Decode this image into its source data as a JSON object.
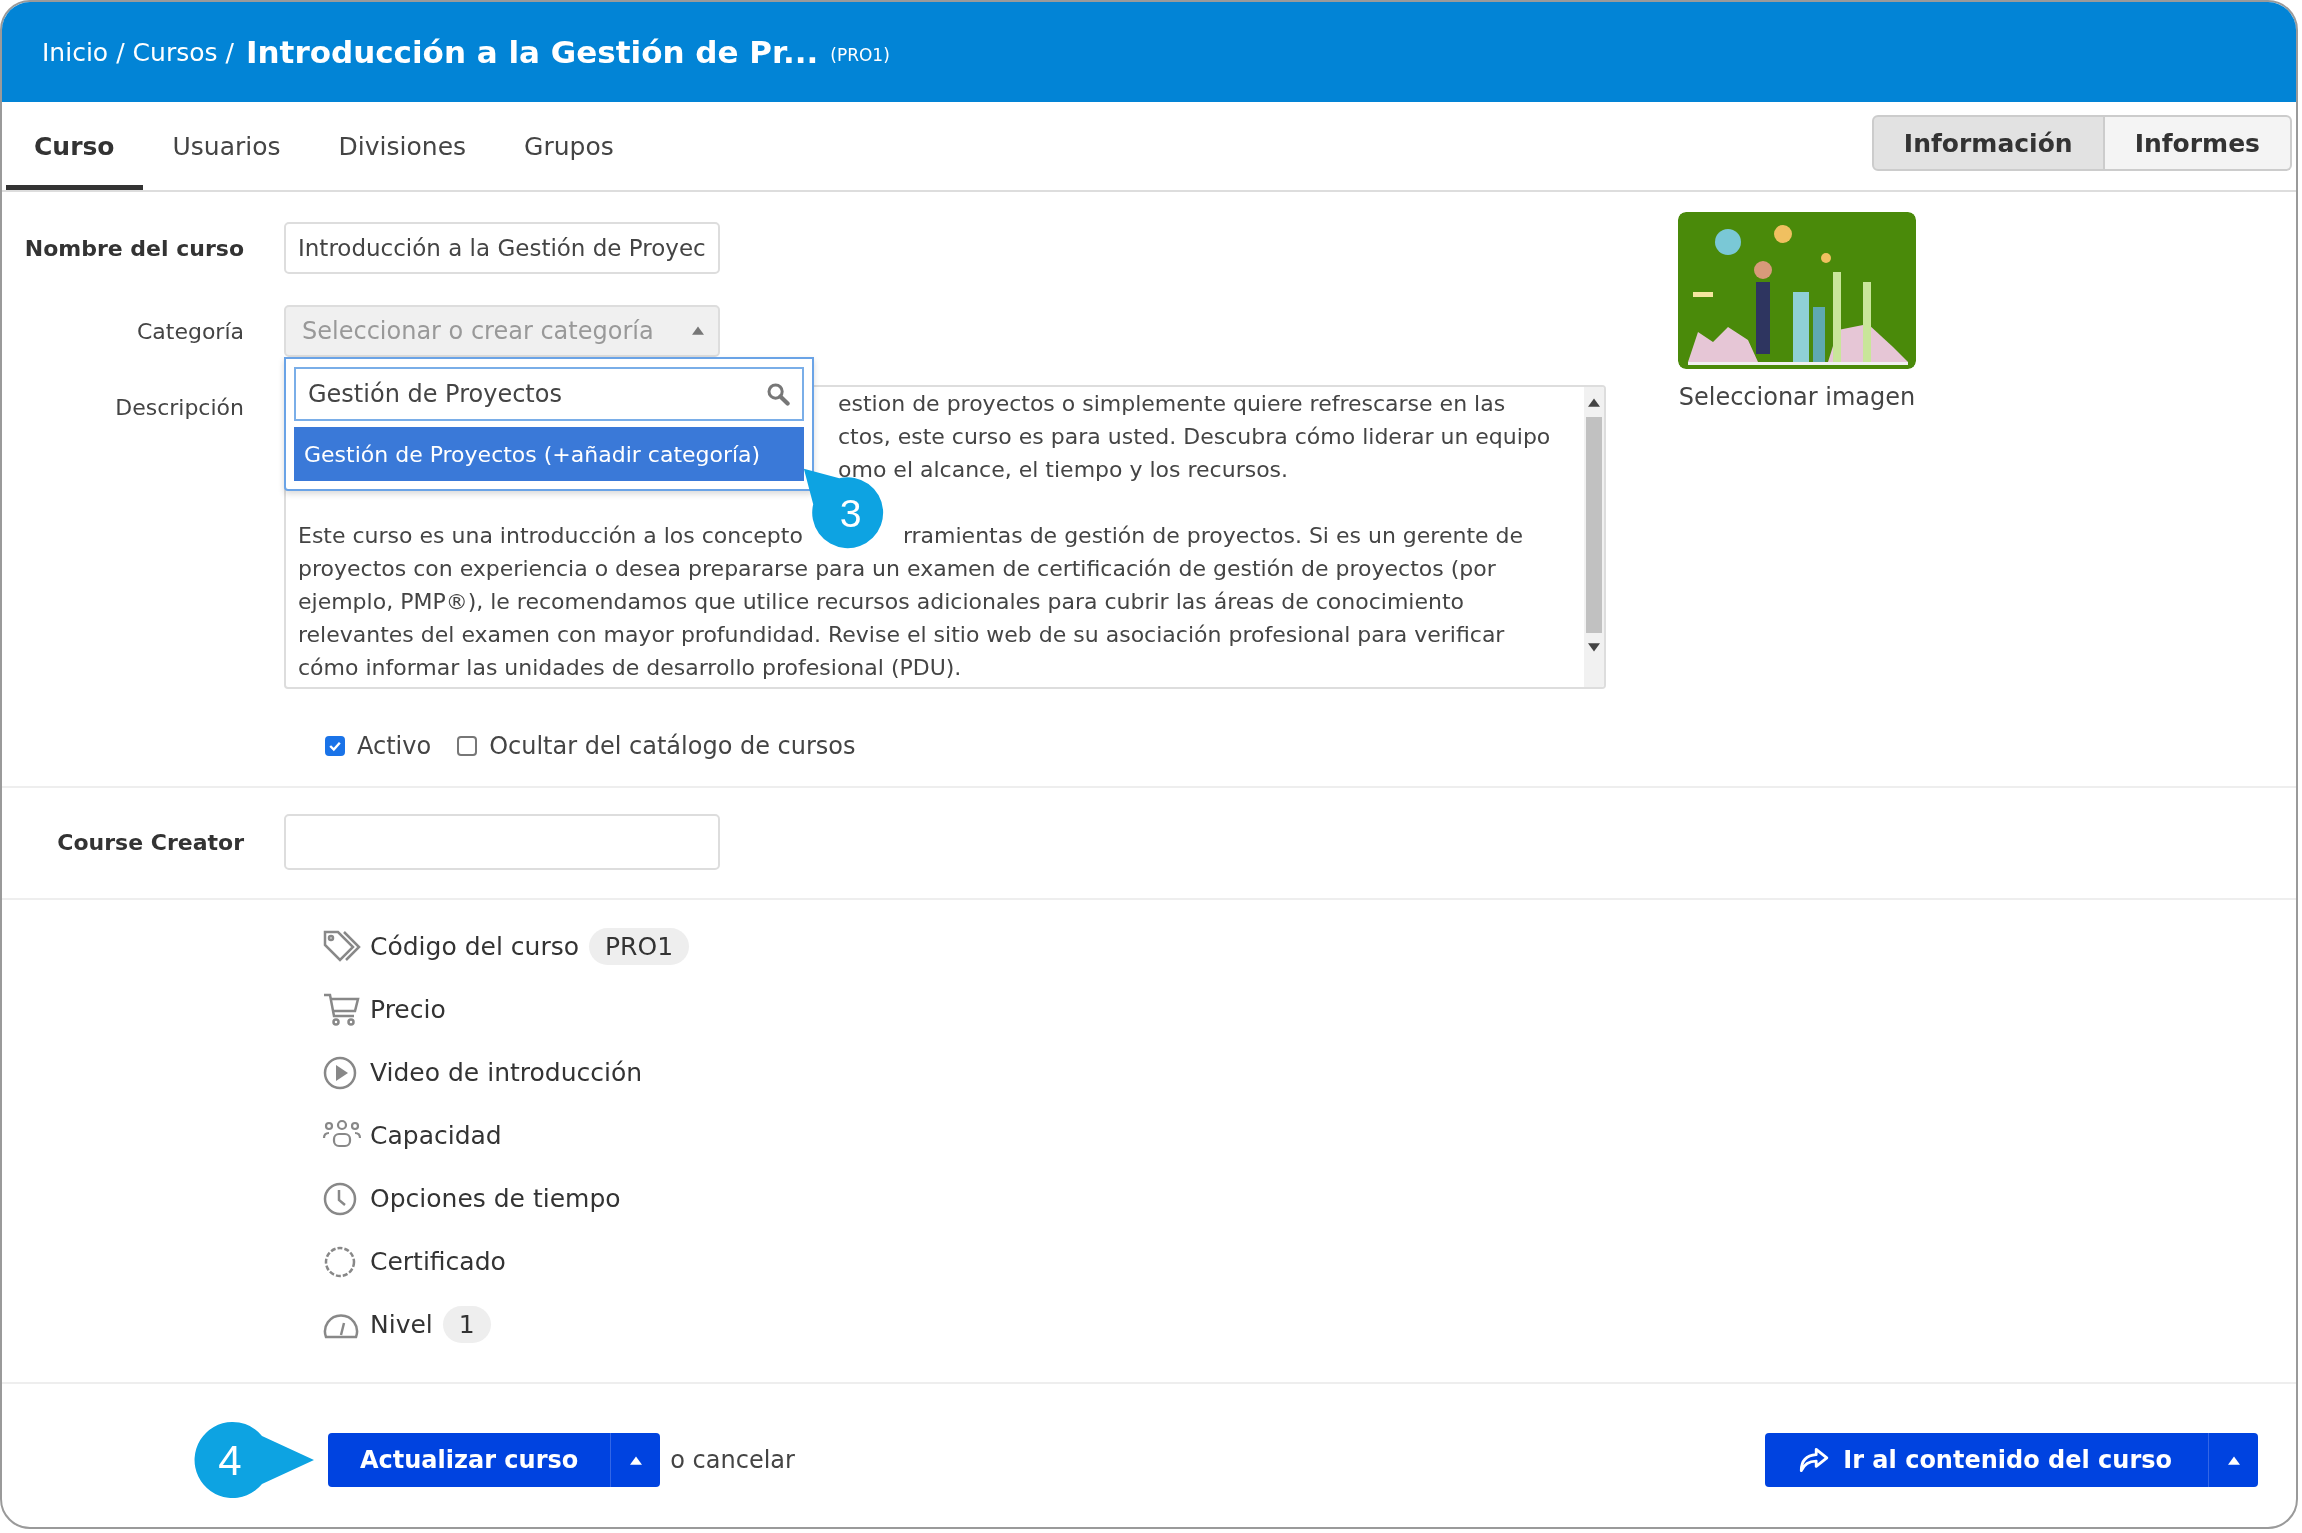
{
  "header": {
    "breadcrumbs": [
      "Inicio",
      "Cursos"
    ],
    "separator": "/",
    "title": "Introducción a la Gestión de Pr...",
    "code": "(PRO1)"
  },
  "tabs": [
    {
      "label": "Curso",
      "selected": true
    },
    {
      "label": "Usuarios",
      "selected": false
    },
    {
      "label": "Divisiones",
      "selected": false
    },
    {
      "label": "Grupos",
      "selected": false
    }
  ],
  "view_toggle": [
    {
      "label": "Información",
      "selected": true
    },
    {
      "label": "Informes",
      "selected": false
    }
  ],
  "form": {
    "name_label": "Nombre del curso",
    "name_value": "Introducción a la Gestión de Proyec",
    "category_label": "Categoría",
    "category_placeholder": "Seleccionar o crear categoría",
    "category_dropdown": {
      "search_value": "Gestión de Proyectos",
      "options": [
        {
          "label": "Gestión de Proyectos (+añadir categoría)",
          "selected": true
        }
      ]
    },
    "description_label": "Descripción",
    "description_lines": [
      {
        "kind": "covered",
        "text": "estion de proyectos o simplemente quiere refrescarse en las"
      },
      {
        "kind": "covered",
        "text": "ctos, este curso es para usted. Descubra cómo liderar un equipo"
      },
      {
        "kind": "covered",
        "text": "omo el alcance, el tiempo y los recursos."
      },
      {
        "kind": "blank"
      },
      {
        "kind": "split",
        "text": "Este curso es una introducción a los concepto",
        "rest": "rramientas de gestión de proyectos. Si es un gerente de"
      },
      {
        "kind": "full",
        "text": "proyectos con experiencia o desea prepararse para un examen de certificación de gestión de proyectos (por"
      },
      {
        "kind": "full",
        "text": "ejemplo, PMP®), le recomendamos que utilice recursos adicionales para cubrir las áreas de conocimiento"
      },
      {
        "kind": "full",
        "text": "relevantes del examen con mayor profundidad. Revise el sitio web de su asociación profesional para verificar"
      },
      {
        "kind": "full",
        "text": "cómo informar las unidades de desarrollo profesional (PDU)."
      }
    ],
    "checkboxes": [
      {
        "label": "Activo",
        "checked": true
      },
      {
        "label": "Ocultar del catálogo de cursos",
        "checked": false
      }
    ],
    "image_label": "Seleccionar imagen",
    "creator_label": "Course Creator"
  },
  "options": [
    {
      "kind": "tag",
      "label": "Código del curso",
      "badge": "PRO1"
    },
    {
      "kind": "cart",
      "label": "Precio"
    },
    {
      "kind": "play",
      "label": "Video de introducción"
    },
    {
      "kind": "people",
      "label": "Capacidad"
    },
    {
      "kind": "clock",
      "label": "Opciones de tiempo"
    },
    {
      "kind": "seal",
      "label": "Certificado"
    },
    {
      "kind": "gauge",
      "label": "Nivel",
      "badge": "1"
    }
  ],
  "footer": {
    "update_button": "Actualizar curso",
    "cancel_text": "o cancelar",
    "content_button": "Ir al contenido del curso"
  },
  "callouts": [
    "3",
    "4"
  ]
}
